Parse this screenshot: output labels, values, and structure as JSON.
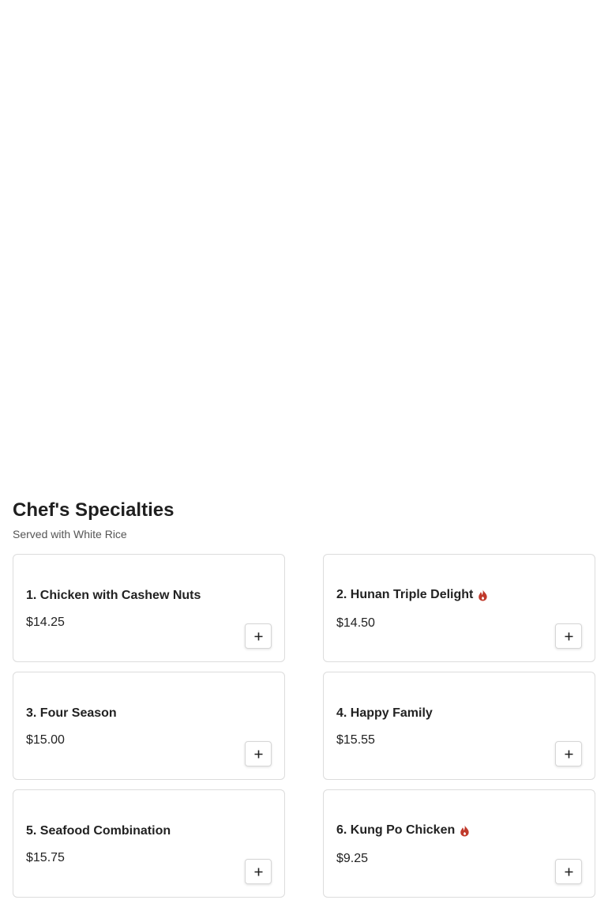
{
  "section": {
    "title": "Chef's Specialties",
    "subtitle": "Served with White Rice"
  },
  "colors": {
    "spicy": "#c0392b",
    "border": "#dcdcdc",
    "text": "#1f1f1f"
  },
  "items": [
    {
      "name": "1. Chicken with Cashew Nuts",
      "price": "$14.25",
      "spicy": false,
      "add_icon": "plus-icon"
    },
    {
      "name": "2. Hunan Triple Delight",
      "price": "$14.50",
      "spicy": true,
      "add_icon": "plus-icon"
    },
    {
      "name": "3. Four Season",
      "price": "$15.00",
      "spicy": false,
      "add_icon": "plus-icon"
    },
    {
      "name": "4. Happy Family",
      "price": "$15.55",
      "spicy": false,
      "add_icon": "plus-icon"
    },
    {
      "name": "5. Seafood Combination",
      "price": "$15.75",
      "spicy": false,
      "add_icon": "plus-icon"
    },
    {
      "name": "6. Kung Po Chicken",
      "price": "$9.25",
      "spicy": true,
      "add_icon": "plus-icon"
    }
  ]
}
